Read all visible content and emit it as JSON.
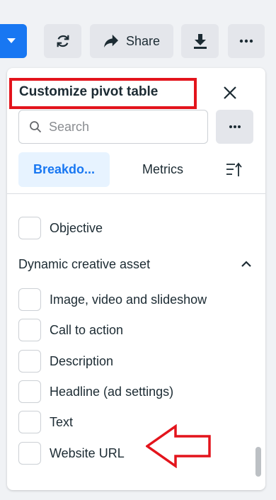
{
  "toolbar": {
    "share_label": "Share"
  },
  "panel": {
    "title": "Customize pivot table",
    "search": {
      "placeholder": "Search",
      "value": ""
    },
    "tabs": [
      {
        "label": "Breakdo...",
        "active": true
      },
      {
        "label": "Metrics",
        "active": false
      }
    ],
    "top_items": [
      {
        "label": "Objective",
        "checked": false
      }
    ],
    "section": {
      "title": "Dynamic creative asset",
      "expanded": true,
      "items": [
        {
          "label": "Image, video and slideshow",
          "checked": false
        },
        {
          "label": "Call to action",
          "checked": false
        },
        {
          "label": "Description",
          "checked": false
        },
        {
          "label": "Headline (ad settings)",
          "checked": false
        },
        {
          "label": "Text",
          "checked": false
        },
        {
          "label": "Website URL",
          "checked": false
        }
      ]
    }
  },
  "colors": {
    "accent": "#1877f2",
    "highlight_red": "#e3141c",
    "button_gray": "#e4e6eb",
    "text": "#1c2b33"
  },
  "icons": [
    "chevron-down-icon",
    "refresh-icon",
    "share-arrow-icon",
    "download-icon",
    "more-horizontal-icon",
    "close-icon",
    "search-icon",
    "sort-icon",
    "chevron-up-icon"
  ]
}
